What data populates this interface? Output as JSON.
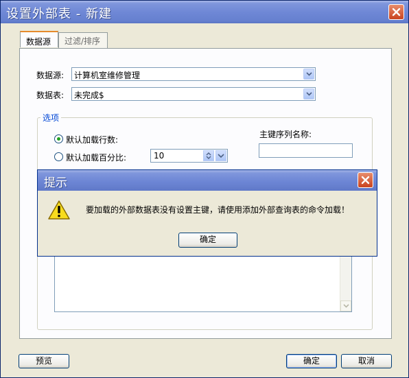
{
  "window": {
    "title": "设置外部表 - 新建"
  },
  "tabs": [
    {
      "label": "数据源",
      "active": true
    },
    {
      "label": "过滤/排序",
      "active": false
    }
  ],
  "form": {
    "source_label": "数据源:",
    "source_value": "计算机室维修管理",
    "table_label": "数据表:",
    "table_value": "未完成$"
  },
  "options": {
    "group_title": "选项",
    "radio_rows_label": "默认加载行数:",
    "radio_rows_selected": true,
    "radio_percent_label": "默认加载百分比:",
    "radio_percent_selected": false,
    "percent_value": "10",
    "pk_label": "主键序列名称:",
    "pk_value": ""
  },
  "buttons": {
    "preview": "预览",
    "ok": "确定",
    "cancel": "取消"
  },
  "message_box": {
    "title": "提示",
    "text": "要加载的外部数据表没有设置主键，请使用添加外部查询表的命令加载！",
    "ok": "确定",
    "icon": "warning-icon"
  },
  "colors": {
    "title_bar": "#6f88d6",
    "close_button": "#c9431f",
    "group_title": "#0046d5",
    "tab_highlight": "#e68b2c",
    "window_face": "#ece9d8"
  }
}
